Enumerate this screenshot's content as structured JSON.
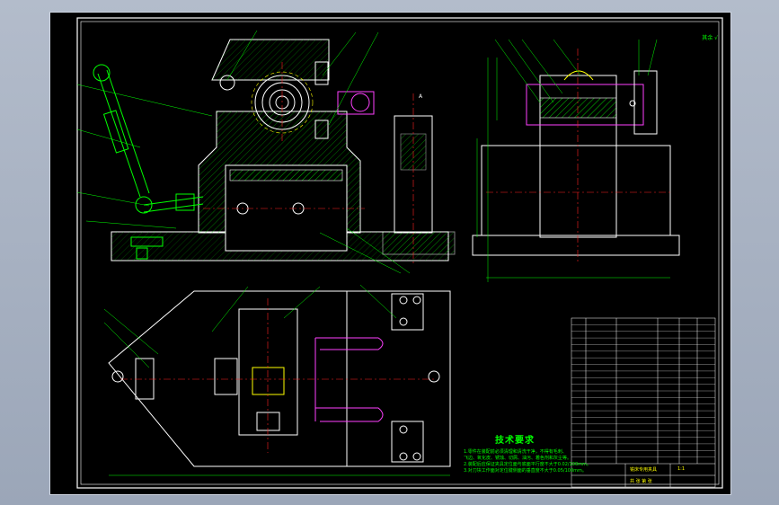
{
  "drawing": {
    "note_top_right": "其余 √",
    "technical_requirements": {
      "title": "技术要求",
      "lines": [
        "1.零件在装配前必须清理和清洗干净，不得有毛刺、",
        "飞边、氧化皮、锈蚀、切屑、油污、着色剂和灰尘等。",
        "2.装配后应保证夹具定位面与底面平行度不大于0.02/100mm。",
        "3.对刀块工作面对定位键侧面的垂直度不大于0.05/100mm。"
      ]
    },
    "title_block": {
      "name": "铣床专用夹具",
      "scale": "1:1",
      "sheet": "共 张 第 张"
    },
    "bom_rows": 22
  }
}
